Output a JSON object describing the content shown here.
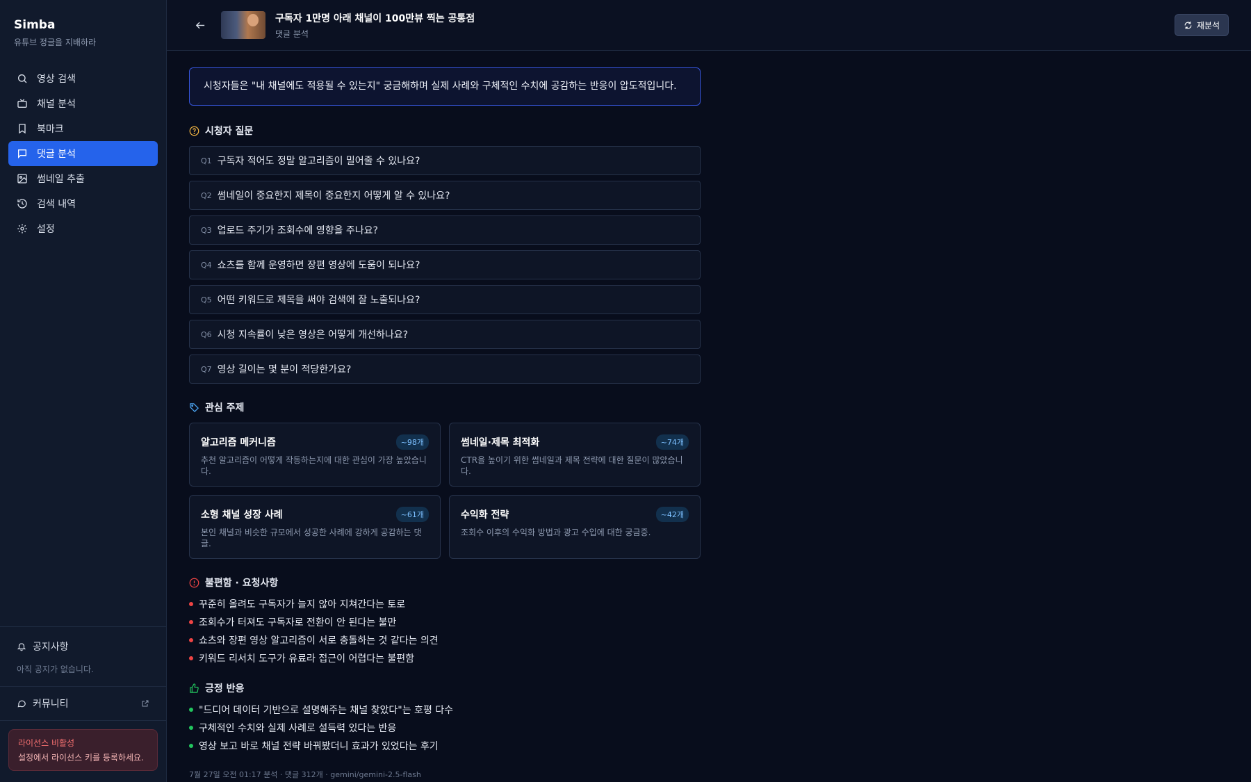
{
  "brand": {
    "title": "Simba",
    "subtitle": "유튜브 정글을 지배하라"
  },
  "nav": [
    {
      "label": "영상 검색",
      "icon": "search-icon",
      "active": false
    },
    {
      "label": "채널 분석",
      "icon": "tv-icon",
      "active": false
    },
    {
      "label": "북마크",
      "icon": "bookmark-icon",
      "active": false
    },
    {
      "label": "댓글 분석",
      "icon": "comment-icon",
      "active": true
    },
    {
      "label": "썸네일 추출",
      "icon": "image-icon",
      "active": false
    },
    {
      "label": "검색 내역",
      "icon": "history-icon",
      "active": false
    },
    {
      "label": "설정",
      "icon": "gear-icon",
      "active": false
    }
  ],
  "notice": {
    "title": "공지사항",
    "empty": "아직 공지가 없습니다."
  },
  "community": {
    "label": "커뮤니티"
  },
  "license": {
    "title": "라이선스 비활성",
    "desc": "설정에서 라이선스 키를 등록하세요."
  },
  "header": {
    "video_title": "구독자 1만명 아래 채널이 100만뷰 찍는 공통점",
    "subtitle": "댓글 분석",
    "reanalyze_label": "재분석"
  },
  "summary": "시청자들은 \"내 채널에도 적용될 수 있는지\" 궁금해하며 실제 사례와 구체적인 수치에 공감하는 반응이 압도적입니다.",
  "questions": {
    "title": "시청자 질문",
    "items": [
      {
        "num": "Q1",
        "text": "구독자 적어도 정말 알고리즘이 밀어줄 수 있나요?"
      },
      {
        "num": "Q2",
        "text": "썸네일이 중요한지 제목이 중요한지 어떻게 알 수 있나요?"
      },
      {
        "num": "Q3",
        "text": "업로드 주기가 조회수에 영향을 주나요?"
      },
      {
        "num": "Q4",
        "text": "쇼츠를 함께 운영하면 장편 영상에 도움이 되나요?"
      },
      {
        "num": "Q5",
        "text": "어떤 키워드로 제목을 써야 검색에 잘 노출되나요?"
      },
      {
        "num": "Q6",
        "text": "시청 지속률이 낮은 영상은 어떻게 개선하나요?"
      },
      {
        "num": "Q7",
        "text": "영상 길이는 몇 분이 적당한가요?"
      }
    ]
  },
  "topics": {
    "title": "관심 주제",
    "items": [
      {
        "title": "알고리즘 메커니즘",
        "count": "~98개",
        "desc": "추천 알고리즘이 어떻게 작동하는지에 대한 관심이 가장 높았습니다."
      },
      {
        "title": "썸네일·제목 최적화",
        "count": "~74개",
        "desc": "CTR을 높이기 위한 썸네일과 제목 전략에 대한 질문이 많았습니다."
      },
      {
        "title": "소형 채널 성장 사례",
        "count": "~61개",
        "desc": "본인 채널과 비슷한 규모에서 성공한 사례에 강하게 공감하는 댓글."
      },
      {
        "title": "수익화 전략",
        "count": "~42개",
        "desc": "조회수 이후의 수익화 방법과 광고 수입에 대한 궁금증."
      }
    ]
  },
  "complaints": {
    "title": "불편함 · 요청사항",
    "items": [
      "꾸준히 올려도 구독자가 늘지 않아 지쳐간다는 토로",
      "조회수가 터져도 구독자로 전환이 안 된다는 불만",
      "쇼츠와 장편 영상 알고리즘이 서로 충돌하는 것 같다는 의견",
      "키워드 리서치 도구가 유료라 접근이 어렵다는 불편함"
    ]
  },
  "positive": {
    "title": "긍정 반응",
    "items": [
      "\"드디어 데이터 기반으로 설명해주는 채널 찾았다\"는 호평 다수",
      "구체적인 수치와 실제 사례로 설득력 있다는 반응",
      "영상 보고 바로 채널 전략 바꿔봤더니 효과가 있었다는 후기"
    ]
  },
  "footer_meta": "7월 27일 오전 01:17 분석 · 댓글 312개 · gemini/gemini-2.5-flash",
  "colors": {
    "accent": "#2563eb",
    "summary_border": "#3654d9",
    "danger": "#ef4444",
    "success": "#22c55e",
    "question_icon": "#f5b642",
    "topic_icon": "#4aa3f0"
  }
}
